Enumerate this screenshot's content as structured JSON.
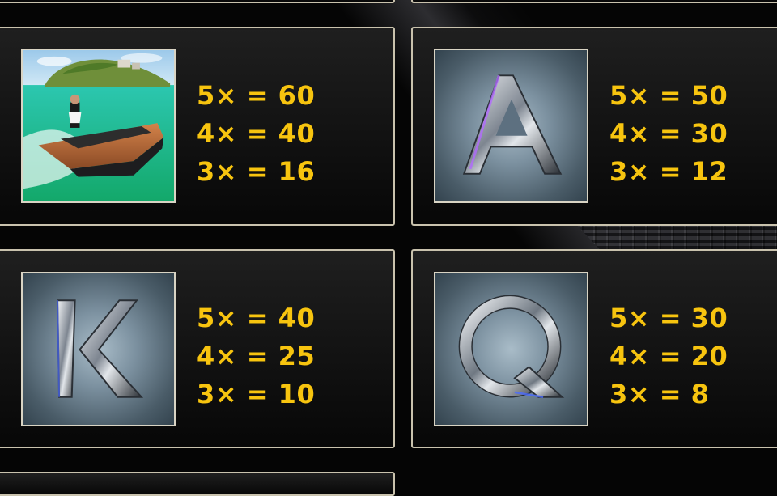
{
  "paytable": [
    {
      "symbol_icon": "speedboat-island-icon",
      "payouts": [
        "5× = 60",
        "4× = 40",
        "3× = 16"
      ]
    },
    {
      "symbol_icon": "letter-a-icon",
      "payouts": [
        "5× = 50",
        "4× = 30",
        "3× = 12"
      ]
    },
    {
      "symbol_icon": "letter-k-icon",
      "payouts": [
        "5× = 40",
        "4× = 25",
        "3× = 10"
      ]
    },
    {
      "symbol_icon": "letter-q-icon",
      "payouts": [
        "5× = 30",
        "4× = 20",
        "3× = 8"
      ]
    }
  ],
  "colors": {
    "payout_text": "#f7c40f",
    "panel_border": "#c9c2ad",
    "panel_background": "#141414",
    "page_background": "#050505"
  }
}
